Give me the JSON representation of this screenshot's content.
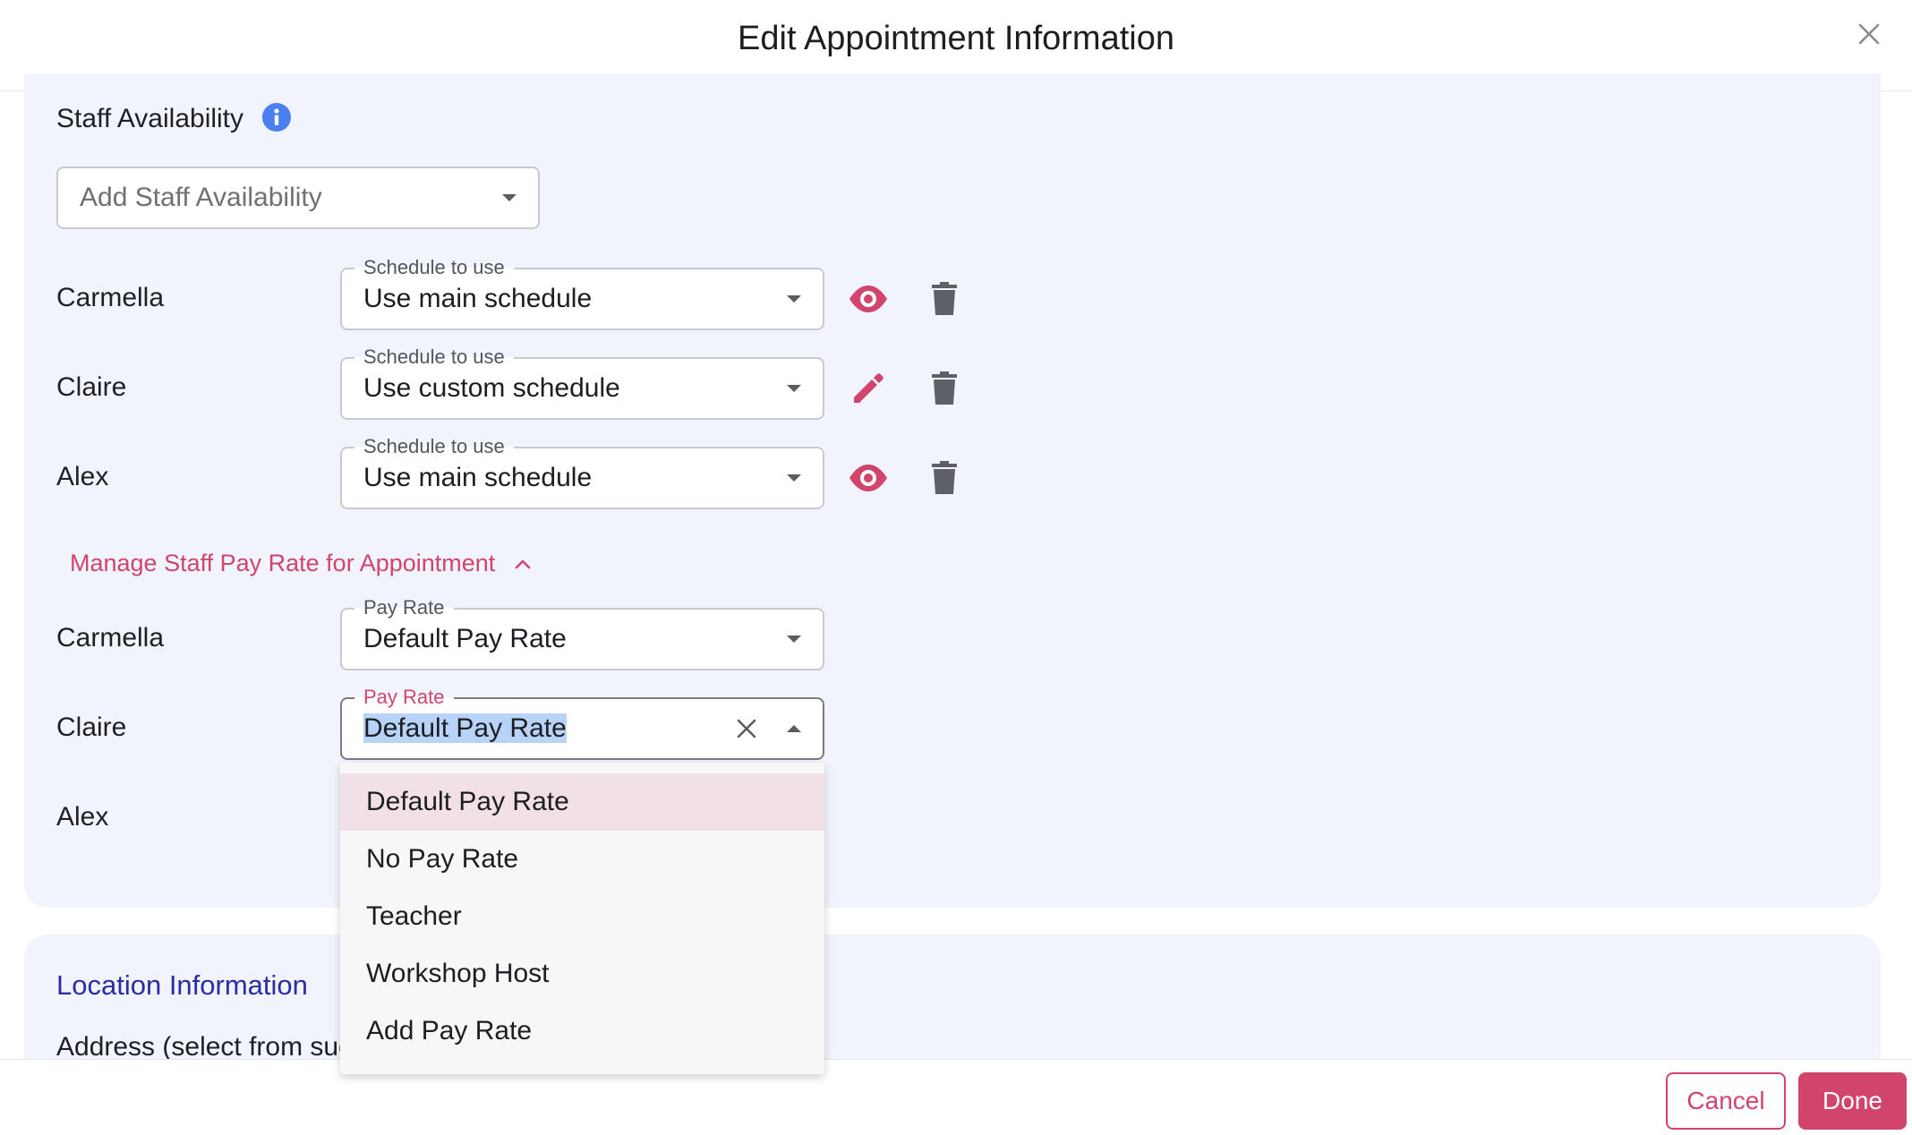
{
  "dialog": {
    "title": "Edit Appointment Information",
    "close_icon": "close-icon"
  },
  "staff_availability": {
    "label": "Staff Availability",
    "info_icon": "info-icon",
    "add_select_placeholder": "Add Staff Availability",
    "rows": [
      {
        "name": "Carmella",
        "field_label": "Schedule to use",
        "value": "Use main schedule",
        "action_icon": "eye-icon",
        "delete_icon": "trash-icon"
      },
      {
        "name": "Claire",
        "field_label": "Schedule to use",
        "value": "Use custom schedule",
        "action_icon": "pencil-icon",
        "delete_icon": "trash-icon"
      },
      {
        "name": "Alex",
        "field_label": "Schedule to use",
        "value": "Use main schedule",
        "action_icon": "eye-icon",
        "delete_icon": "trash-icon"
      }
    ]
  },
  "pay_rate": {
    "toggle_label": "Manage Staff Pay Rate for Appointment",
    "toggle_icon": "chevron-up-icon",
    "rows": [
      {
        "name": "Carmella",
        "field_label": "Pay Rate",
        "value": "Default Pay Rate"
      },
      {
        "name": "Claire",
        "field_label": "Pay Rate",
        "value": "Default Pay Rate"
      },
      {
        "name": "Alex"
      }
    ],
    "dropdown_options": [
      "Default Pay Rate",
      "No Pay Rate",
      "Teacher",
      "Workshop Host",
      "Add Pay Rate"
    ]
  },
  "location": {
    "title": "Location Information",
    "address_label": "Address (select from suggestions)"
  },
  "footer": {
    "cancel_label": "Cancel",
    "done_label": "Done"
  },
  "colors": {
    "accent": "#d1456d",
    "card_background": "#f1f4fc",
    "location_title": "#2a2da3",
    "info_icon": "#4a7ff0"
  }
}
